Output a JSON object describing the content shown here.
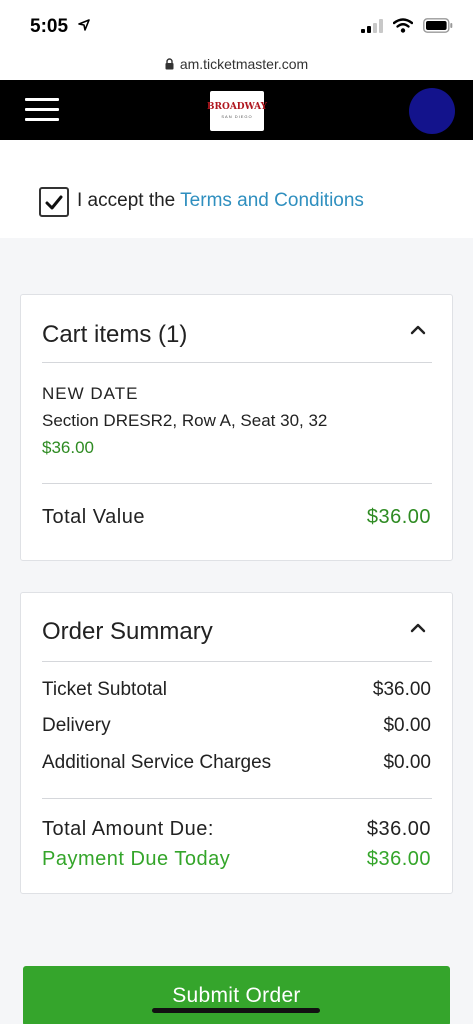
{
  "status": {
    "time": "5:05"
  },
  "browser": {
    "url": "am.ticketmaster.com"
  },
  "header": {
    "logo_text": "BROADWAY",
    "logo_sub": "SAN DIEGO"
  },
  "terms": {
    "prefix": "I accept the ",
    "link": "Terms and Conditions",
    "checked": true
  },
  "cart": {
    "title": "Cart items (1)",
    "item_name": "NEW DATE",
    "item_detail": "Section DRESR2, Row A, Seat 30, 32",
    "item_price": "$36.00",
    "total_label": "Total Value",
    "total_value": "$36.00"
  },
  "summary": {
    "title": "Order Summary",
    "rows": [
      {
        "label": "Ticket Subtotal",
        "value": "$36.00"
      },
      {
        "label": "Delivery",
        "value": "$0.00"
      },
      {
        "label": "Additional Service Charges",
        "value": "$0.00"
      }
    ],
    "total_label": "Total Amount Due:",
    "total_value": "$36.00",
    "due_label": "Payment Due Today",
    "due_value": "$36.00"
  },
  "submit_label": "Submit Order",
  "colors": {
    "accent_green": "#35a52c",
    "link_blue": "#2f8fbf",
    "nav_bg": "#000000",
    "avatar": "#13138c"
  },
  "icons": [
    "location-arrow-icon",
    "signal-icon",
    "wifi-icon",
    "battery-icon",
    "lock-icon",
    "hamburger-menu-icon",
    "checkmark-icon",
    "chevron-up-icon"
  ]
}
